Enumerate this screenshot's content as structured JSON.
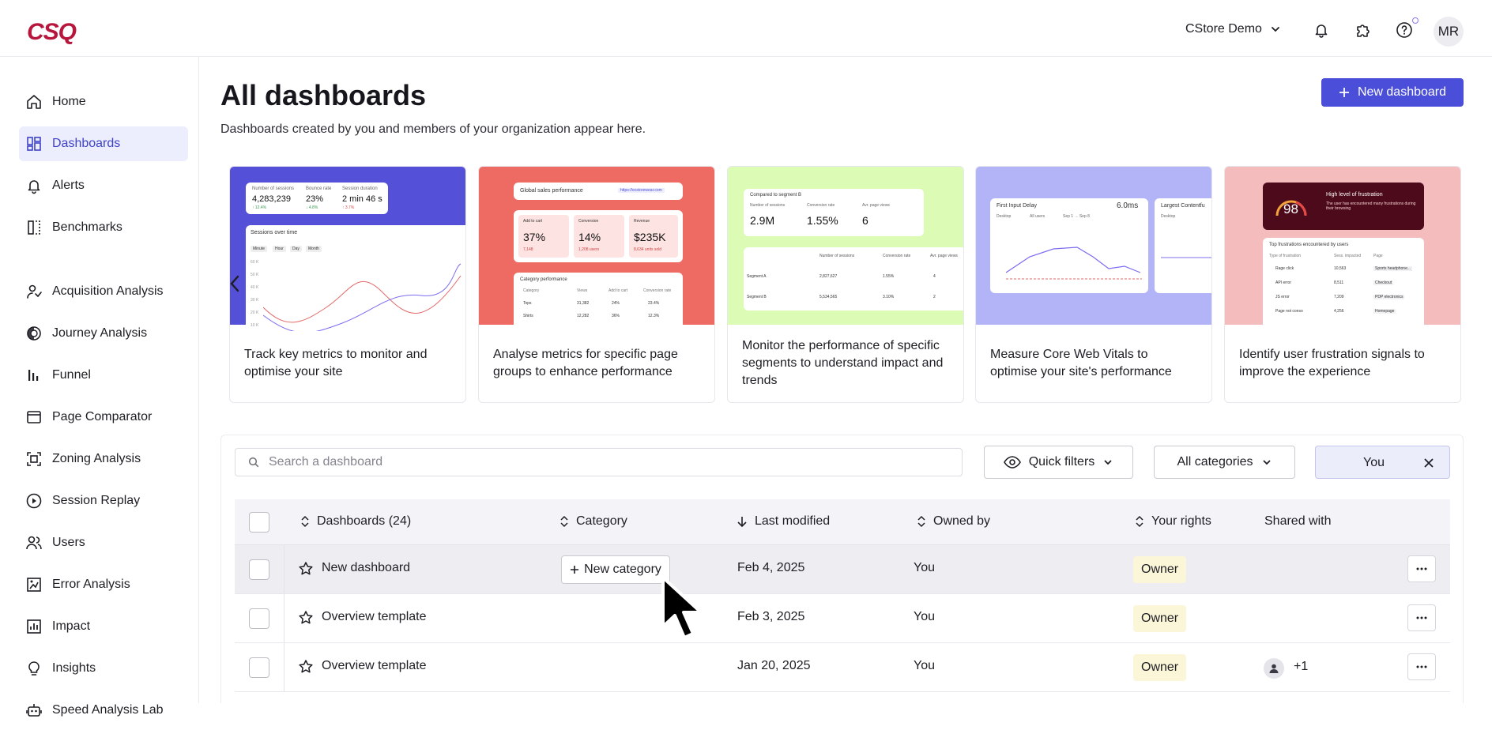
{
  "app": {
    "logo": "CSQ"
  },
  "header": {
    "org": "CStore Demo",
    "avatar_initials": "MR",
    "icons": [
      "bell-icon",
      "puzzle-icon",
      "help-icon"
    ]
  },
  "sidebar": {
    "items": [
      {
        "label": "Home",
        "icon": "home-icon",
        "active": false
      },
      {
        "label": "Dashboards",
        "icon": "dashboard-icon",
        "active": true
      },
      {
        "label": "Alerts",
        "icon": "bell-icon",
        "active": false
      },
      {
        "label": "Benchmarks",
        "icon": "benchmark-icon",
        "active": false
      },
      {
        "label": "Acquisition Analysis",
        "icon": "acquisition-icon",
        "active": false
      },
      {
        "label": "Journey Analysis",
        "icon": "journey-icon",
        "active": false
      },
      {
        "label": "Funnel",
        "icon": "funnel-icon",
        "active": false
      },
      {
        "label": "Page Comparator",
        "icon": "page-comparator-icon",
        "active": false
      },
      {
        "label": "Zoning Analysis",
        "icon": "zoning-icon",
        "active": false
      },
      {
        "label": "Session Replay",
        "icon": "play-icon",
        "active": false
      },
      {
        "label": "Users",
        "icon": "users-icon",
        "active": false
      },
      {
        "label": "Error Analysis",
        "icon": "error-icon",
        "active": false
      },
      {
        "label": "Impact",
        "icon": "impact-icon",
        "active": false
      },
      {
        "label": "Insights",
        "icon": "lightbulb-icon",
        "active": false
      },
      {
        "label": "Speed Analysis Lab",
        "icon": "robot-icon",
        "active": false
      }
    ]
  },
  "main": {
    "title": "All dashboards",
    "subtitle": "Dashboards created by you and members of your organization appear here.",
    "new_dashboard_label": "New dashboard"
  },
  "templates": [
    {
      "text": "Track key metrics to monitor and optimise your site",
      "bg": "#5550d8",
      "preview": {
        "metrics": [
          {
            "label": "Number of sessions",
            "value": "4,283,239",
            "delta": "↑ 12.4%"
          },
          {
            "label": "Bounce rate",
            "value": "23%",
            "delta": "↓ 4.8%"
          },
          {
            "label": "Session duration",
            "value": "2 min 46 s",
            "delta": "↑ 3.7%"
          }
        ],
        "chart_title": "Sessions over time",
        "tabs": [
          "Minute",
          "Hour",
          "Day",
          "Month"
        ],
        "y_ticks": [
          "60 K",
          "50 K",
          "40 K",
          "30 K",
          "20 K",
          "10 K"
        ]
      }
    },
    {
      "text": "Analyse metrics for specific page groups to enhance performance",
      "bg": "#ee6b64",
      "preview": {
        "title": "Global sales performance",
        "url": "https://ecstorewear.com",
        "kpis": [
          {
            "label": "Add to cart",
            "value": "37%",
            "sub": "7,148"
          },
          {
            "label": "Conversion",
            "value": "14%",
            "sub": "1,208 users"
          },
          {
            "label": "Revenue",
            "value": "$235K",
            "sub": "8,634 units sold"
          }
        ],
        "table_title": "Category performance",
        "headers": [
          "Category",
          "Views",
          "Add to cart",
          "Conversion rate"
        ],
        "rows": [
          [
            "Tops",
            "31,382",
            "24%",
            "23.4%"
          ],
          [
            "Shirts",
            "12,282",
            "36%",
            "12.3%"
          ]
        ]
      }
    },
    {
      "text": "Monitor the performance of specific segments to understand impact and trends",
      "bg": "#dcfbb5",
      "preview": {
        "title": "Compared to segment B",
        "metrics": [
          {
            "label": "Number of sessions",
            "value": "2.9M"
          },
          {
            "label": "Conversion rate",
            "value": "1.55%"
          },
          {
            "label": "Avr. page views",
            "value": "6"
          }
        ],
        "headers": [
          "Number of sessions",
          "Conversion rate",
          "Avr. page views"
        ],
        "rows": [
          [
            "Segment A",
            "2,827,627",
            "1.55%",
            "4"
          ],
          [
            "Segment B",
            "5,534,565",
            "3.10%",
            "2"
          ]
        ]
      }
    },
    {
      "text": "Measure Core Web Vitals to optimise your site's performance",
      "bg": "#b3b3f7",
      "preview": {
        "title": "First Input Delay",
        "value": "6.0ms",
        "filters": [
          "Desktop",
          "All users",
          "Sep 1 → Sep 8"
        ],
        "second_title": "Largest Contentfu",
        "second_filter": "Desktop"
      }
    },
    {
      "text": "Identify user frustration signals to improve the experience",
      "bg": "#f4bcbc",
      "preview": {
        "score": "98",
        "score_title": "High level of frustration",
        "score_sub": "The user has encountered many frustrations during their browsing",
        "list_title": "Top frustrations encountered by users",
        "headers": [
          "Type of frustration",
          "Sess. impacted",
          "Page"
        ],
        "rows": [
          [
            "Rage click",
            "10,563",
            "Sports headphone..."
          ],
          [
            "API error",
            "8,511",
            "Checkout"
          ],
          [
            "JS error",
            "7,209",
            "PDP electronics"
          ],
          [
            "Page not conso",
            "4,256",
            "Homepage"
          ]
        ]
      }
    }
  ],
  "toolbar": {
    "search_placeholder": "Search a dashboard",
    "quick_filters": "Quick filters",
    "categories": "All categories",
    "owner_chip": "You"
  },
  "table": {
    "headers": {
      "name": "Dashboards (24)",
      "category": "Category",
      "modified": "Last modified",
      "owner": "Owned by",
      "rights": "Your rights",
      "shared": "Shared with"
    },
    "new_category_label": "New category",
    "rows": [
      {
        "name": "New dashboard",
        "category": "",
        "modified": "Feb 4, 2025",
        "owner": "You",
        "rights": "Owner",
        "shared_more": ""
      },
      {
        "name": "Overview template",
        "category": "",
        "modified": "Feb 3, 2025",
        "owner": "You",
        "rights": "Owner",
        "shared_more": ""
      },
      {
        "name": "Overview template",
        "category": "",
        "modified": "Jan 20, 2025",
        "owner": "You",
        "rights": "Owner",
        "shared_more": "+1"
      }
    ]
  },
  "colors": {
    "accent": "#4a4ed8",
    "active_nav_bg": "#eceefd",
    "owner_badge": "#fbf6d8",
    "brand": "#b8173d"
  }
}
